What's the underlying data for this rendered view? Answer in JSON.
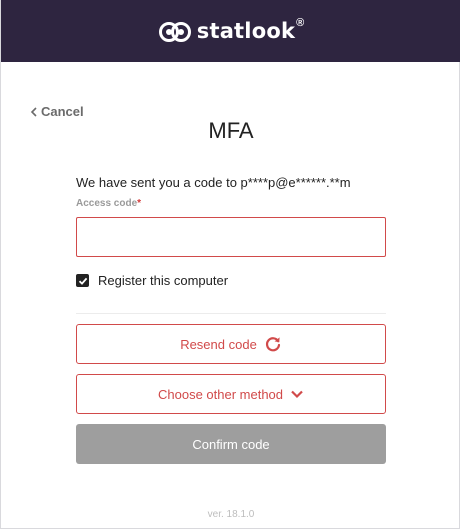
{
  "brand": {
    "name": "statlook",
    "registered_mark": "®",
    "logo_icon": "statlook-logo-icon"
  },
  "nav": {
    "cancel_label": "Cancel",
    "cancel_icon": "chevron-left-icon"
  },
  "page": {
    "title": "MFA"
  },
  "message": {
    "sent_text": "We have sent you a code to p****p@e******.**m"
  },
  "access_code": {
    "label": "Access code",
    "required_mark": "*",
    "value": "",
    "placeholder": ""
  },
  "remember": {
    "label": "Register this computer",
    "checked": true
  },
  "buttons": {
    "resend_label": "Resend code",
    "resend_icon": "refresh-icon",
    "other_method_label": "Choose other method",
    "other_method_icon": "chevron-down-icon",
    "confirm_label": "Confirm code"
  },
  "footer": {
    "version": "ver. 18.1.0"
  },
  "colors": {
    "header_bg": "#2e2540",
    "accent_red": "#d14a4a",
    "confirm_disabled": "#9e9e9e"
  }
}
